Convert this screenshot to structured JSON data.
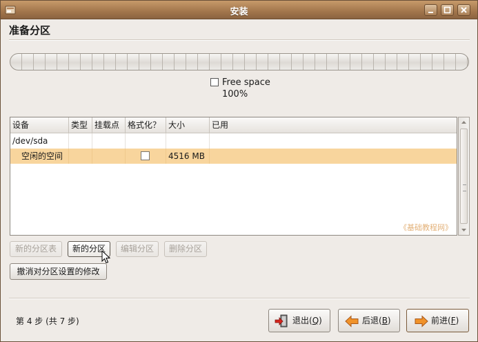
{
  "window": {
    "title": "安装"
  },
  "page": {
    "title": "准备分区"
  },
  "partition_bar": {
    "legend_label": "Free space",
    "legend_percent": "100%",
    "free_fraction": 1.0
  },
  "table": {
    "columns": [
      "设备",
      "类型",
      "挂载点",
      "格式化？",
      "大小",
      "已用"
    ],
    "rows": [
      {
        "device": "/dev/sda",
        "type": "",
        "mount": "",
        "format": "",
        "size": "",
        "used": "",
        "selected": false
      },
      {
        "device": "空闲的空间",
        "type": "",
        "mount": "",
        "format": "unchecked",
        "size": "4516 MB",
        "used": "",
        "selected": true
      }
    ],
    "watermark": "《基础教程网》"
  },
  "buttons": {
    "new_table": "新的分区表",
    "new_partition": "新的分区",
    "edit_partition": "编辑分区",
    "delete_partition": "删除分区",
    "undo_changes": "撤消对分区设置的修改"
  },
  "footer": {
    "step": "第 4 步 (共 7 步)",
    "quit": "退出(",
    "quit_key": "Q",
    "back": "后退(",
    "back_key": "B",
    "forward": "前进(",
    "forward_key": "F",
    "close_paren": ")"
  },
  "colors": {
    "titlebar": "#a2764c",
    "selected_row": "#f8d59d",
    "arrow_orange": "#f0922a",
    "quit_red": "#d8261e"
  }
}
